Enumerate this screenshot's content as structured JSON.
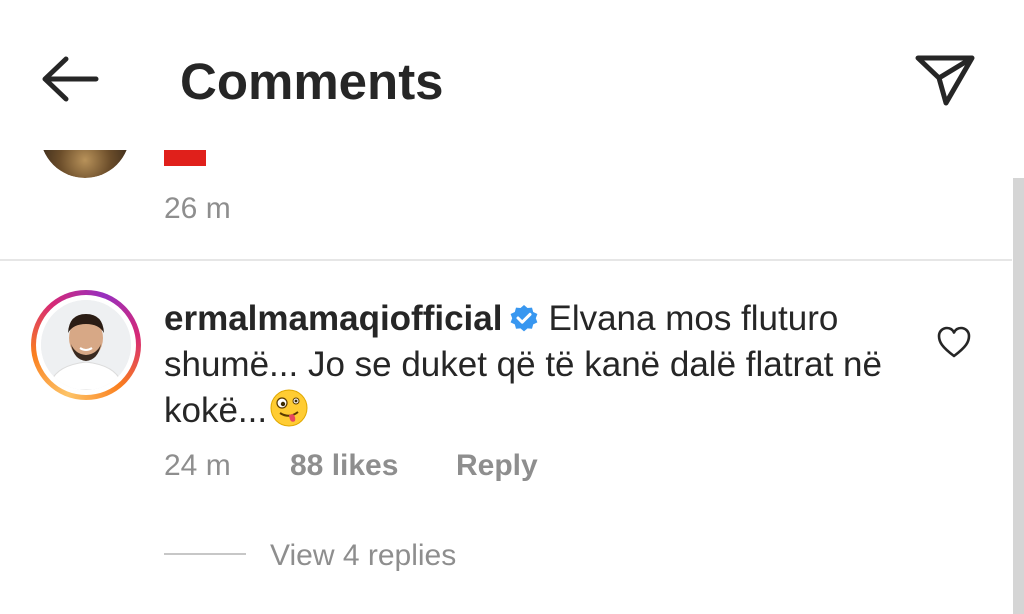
{
  "header": {
    "title": "Comments",
    "back_icon": "arrow-left-icon",
    "send_icon": "paper-plane-icon"
  },
  "previous_comment": {
    "time": "26 m"
  },
  "comment": {
    "username": "ermalmamaqiofficial",
    "verified": true,
    "text": "Elvana mos fluturo shumë... Jo se duket që të kanë dalë flatrat në kokë...",
    "emoji": "zany-face-emoji",
    "time": "24 m",
    "likes": "88 likes",
    "reply_label": "Reply",
    "view_replies": "View 4 replies"
  },
  "colors": {
    "text": "#262626",
    "secondary": "#8e8e8e",
    "verified_blue": "#3897f0",
    "divider": "#e6e6e6"
  }
}
